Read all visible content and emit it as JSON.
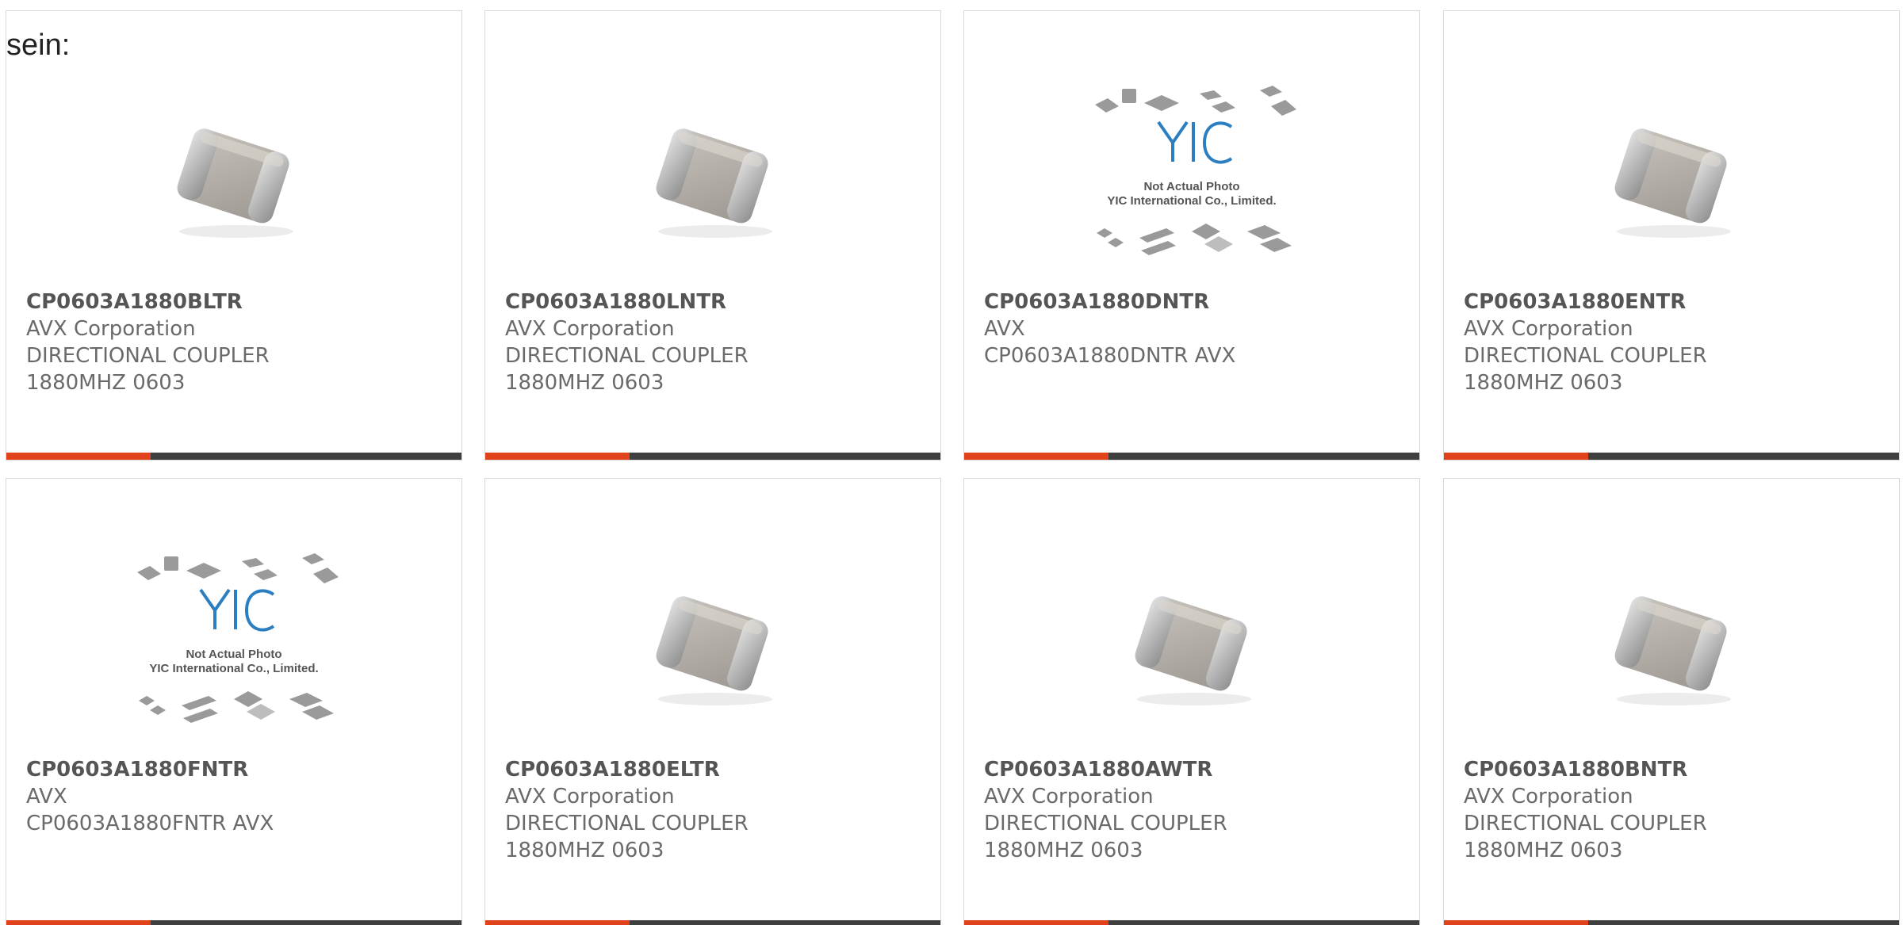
{
  "heading": "sein:",
  "colors": {
    "accent": "#e0431b",
    "bar": "#3f3f3f",
    "yic_blue": "#2b7fc1",
    "text": "#6a6a6a"
  },
  "placeholder": {
    "brand": "YIC",
    "line1": "Not Actual Photo",
    "line2": "YIC International Co., Limited."
  },
  "products": [
    {
      "part": "CP0603A1880BLTR",
      "manufacturer": "AVX Corporation",
      "desc1": "DIRECTIONAL COUPLER",
      "desc2": "1880MHZ 0603",
      "image": "chip-photo"
    },
    {
      "part": "CP0603A1880LNTR",
      "manufacturer": "AVX Corporation",
      "desc1": "DIRECTIONAL COUPLER",
      "desc2": "1880MHZ 0603",
      "image": "chip-photo"
    },
    {
      "part": "CP0603A1880DNTR",
      "manufacturer": "AVX",
      "desc1": "CP0603A1880DNTR AVX",
      "desc2": "",
      "image": "placeholder-photo"
    },
    {
      "part": "CP0603A1880ENTR",
      "manufacturer": "AVX Corporation",
      "desc1": "DIRECTIONAL COUPLER",
      "desc2": "1880MHZ 0603",
      "image": "chip-photo"
    },
    {
      "part": "CP0603A1880FNTR",
      "manufacturer": "AVX",
      "desc1": "CP0603A1880FNTR AVX",
      "desc2": "",
      "image": "placeholder-photo"
    },
    {
      "part": "CP0603A1880ELTR",
      "manufacturer": "AVX Corporation",
      "desc1": "DIRECTIONAL COUPLER",
      "desc2": "1880MHZ 0603",
      "image": "chip-photo"
    },
    {
      "part": "CP0603A1880AWTR",
      "manufacturer": "AVX Corporation",
      "desc1": "DIRECTIONAL COUPLER",
      "desc2": "1880MHZ 0603",
      "image": "chip-photo"
    },
    {
      "part": "CP0603A1880BNTR",
      "manufacturer": "AVX Corporation",
      "desc1": "DIRECTIONAL COUPLER",
      "desc2": "1880MHZ 0603",
      "image": "chip-photo"
    }
  ]
}
